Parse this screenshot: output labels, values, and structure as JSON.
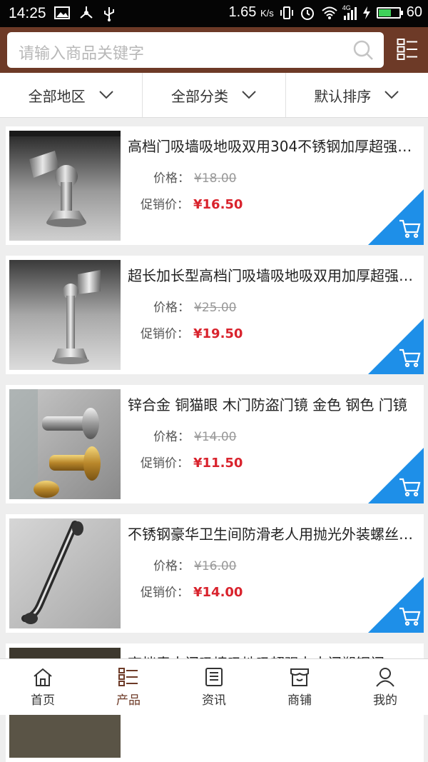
{
  "status_bar": {
    "time": "14:25",
    "network_speed": "1.65",
    "speed_unit": "K/s",
    "network_type": "4G",
    "battery_percent": "60",
    "battery_level": 0.6
  },
  "search": {
    "placeholder": "请输入商品关键字"
  },
  "filters": [
    {
      "label": "全部地区"
    },
    {
      "label": "全部分类"
    },
    {
      "label": "默认排序"
    }
  ],
  "price_label": "价格：",
  "promo_label": "促销价：",
  "products": [
    {
      "title": "高档门吸墙吸地吸双用304不锈钢加厚超强磁门碰",
      "price": "¥18.00",
      "promo": "¥16.50"
    },
    {
      "title": "超长加长型高档门吸墙吸地吸双用加厚超强磁门碰",
      "price": "¥25.00",
      "promo": "¥19.50"
    },
    {
      "title": "锌合金 铜猫眼 木门防盗门镜 金色 钢色 门镜",
      "price": "¥14.00",
      "promo": "¥11.50"
    },
    {
      "title": "不锈钢豪华卫生间防滑老人用抛光外装螺丝扶手",
      "price": "¥16.00",
      "promo": "¥14.00"
    },
    {
      "title": "高档青古门吸墙吸地吸超强力木门塑钢门",
      "price": "",
      "promo": ""
    }
  ],
  "tabs": [
    {
      "label": "首页",
      "icon": "home-icon"
    },
    {
      "label": "产品",
      "icon": "product-list-icon",
      "active": true
    },
    {
      "label": "资讯",
      "icon": "news-icon"
    },
    {
      "label": "商铺",
      "icon": "shop-icon"
    },
    {
      "label": "我的",
      "icon": "user-icon"
    }
  ],
  "colors": {
    "header": "#6d3a27",
    "price_red": "#d9232d",
    "cart_blue": "#1e8fe8"
  }
}
